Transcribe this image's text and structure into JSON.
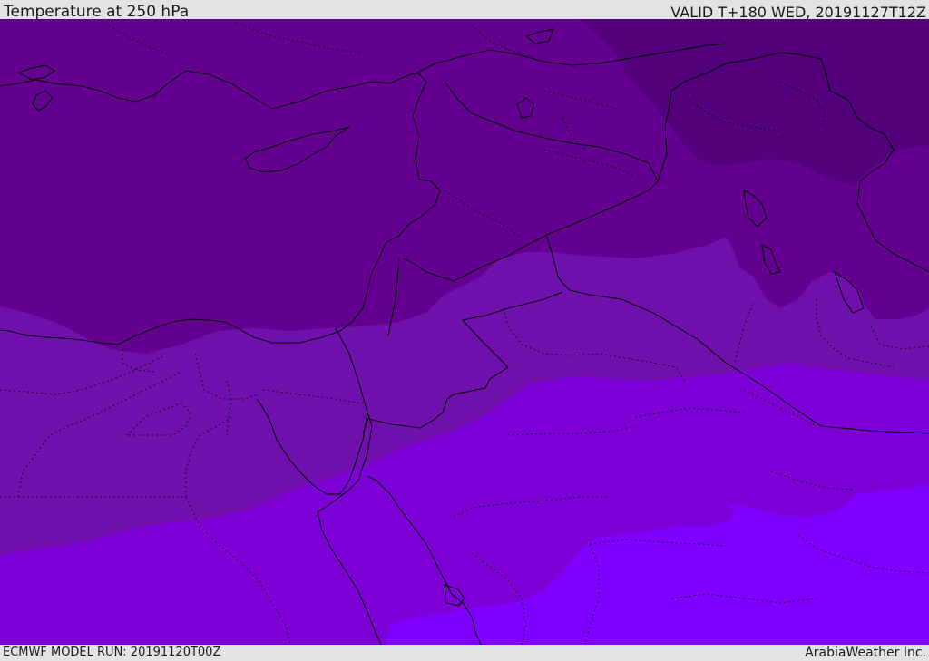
{
  "header": {
    "title": "Temperature at 250 hPa",
    "valid": "VALID T+180 WED, 20191127T12Z"
  },
  "footer": {
    "model_run": "ECMWF MODEL RUN: 20191120T00Z",
    "credit": "ArabiaWeather Inc."
  },
  "map": {
    "variable": "temperature",
    "level": "250 hPa",
    "colors": {
      "darkest": "#52007c",
      "band_1": "#63008f",
      "band_2": "#7010ac",
      "band_3": "#7d00d7",
      "band_4": "#8000ff",
      "coastline": "#000000"
    }
  }
}
